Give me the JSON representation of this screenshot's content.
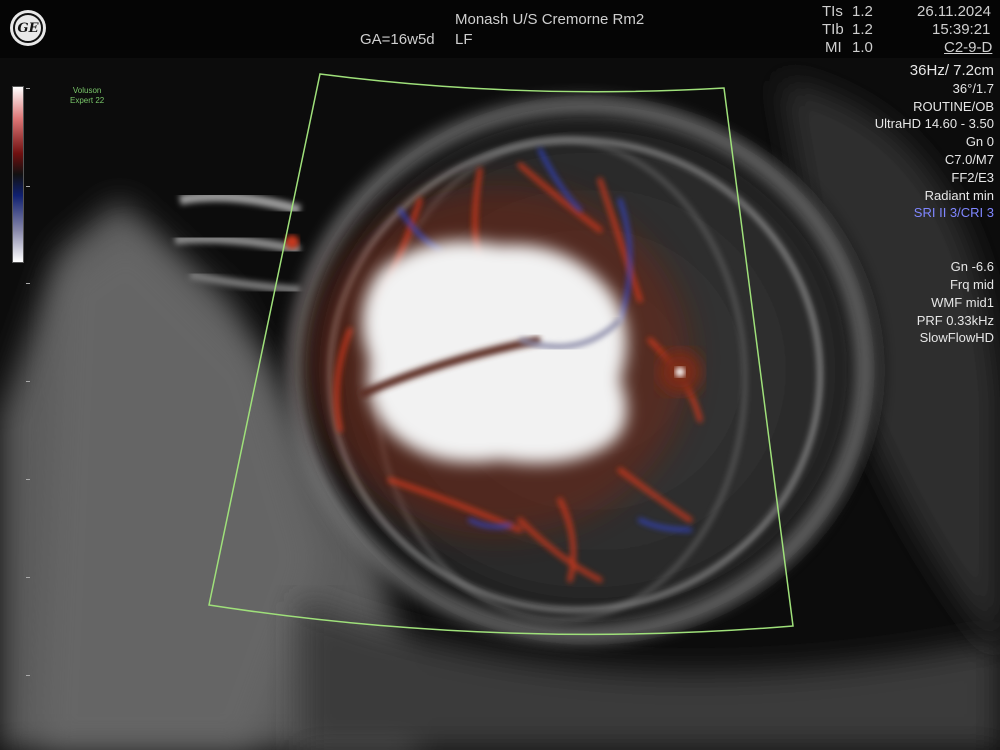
{
  "header": {
    "site": "Monash U/S Cremorne Rm2",
    "ga": "GA=16w5d",
    "side": "LF",
    "tis_label": "TIs",
    "tis_value": "1.2",
    "tib_label": "TIb",
    "tib_value": "1.2",
    "mi_label": "MI",
    "mi_value": "1.0",
    "date": "26.11.2024",
    "time": "15:39:21",
    "probe": "C2-9-D"
  },
  "device": {
    "line1": "Voluson",
    "line2": "Expert 22"
  },
  "params": {
    "rate_depth": "36Hz/ 7.2cm",
    "angle": "36°/1.7",
    "preset": "ROUTINE/OB",
    "ultrahd": "UltraHD 14.60 - 3.50",
    "gain": "Gn  0",
    "cm": "C7.0/M7",
    "ff": "FF2/E3",
    "radiant": "Radiant min",
    "sri": "SRI II 3/CRI 3",
    "flow_gain": "Gn -6.6",
    "frq": "Frq mid",
    "wmf": "WMF mid1",
    "prf": "PRF 0.33kHz",
    "mode": "SlowFlowHD"
  },
  "colors": {
    "accent_blue": "#7f86ff",
    "roi_green": "#9fe07a",
    "doppler_red": "#c8391e",
    "doppler_blue": "#3344cc"
  }
}
